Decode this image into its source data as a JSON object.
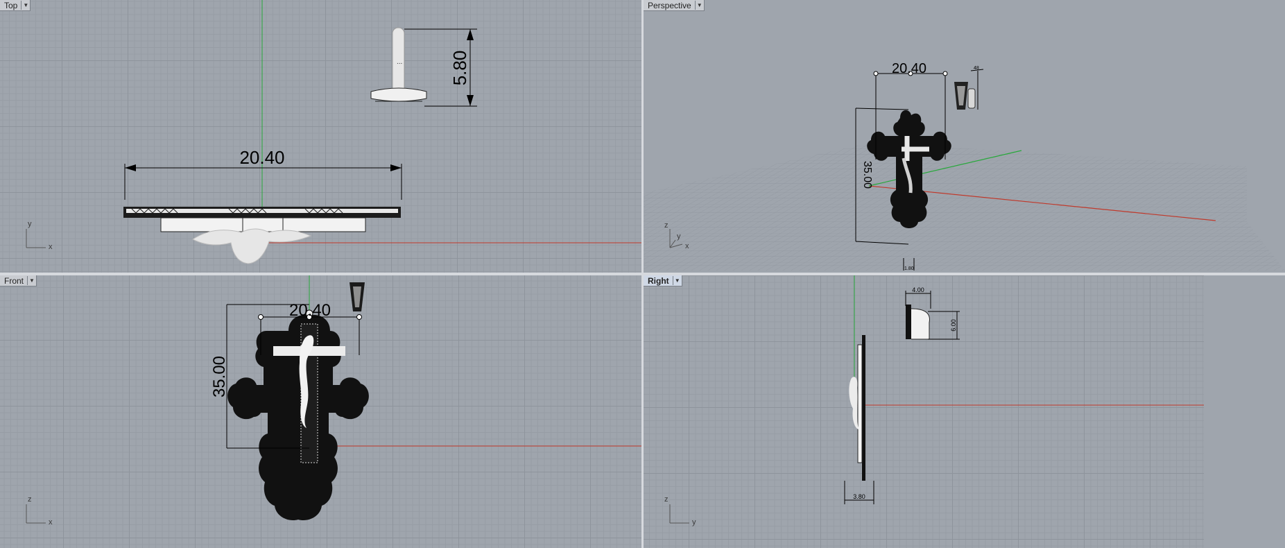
{
  "viewports": {
    "top": {
      "label": "Top"
    },
    "perspective": {
      "label": "Perspective"
    },
    "front": {
      "label": "Front"
    },
    "right": {
      "label": "Right"
    }
  },
  "dimensions": {
    "top_width": "20.40",
    "top_depth": "5.80",
    "persp_width": "20.40",
    "persp_height": "35.00",
    "persp_small": "48",
    "persp_bottom": "1.80",
    "front_width": "20.40",
    "front_height": "35.00",
    "right_bail_width": "4.00",
    "right_bail_height": "6.00",
    "right_thickness": "3.80"
  },
  "axes": {
    "top": {
      "h": "x",
      "v": "y"
    },
    "persp": {
      "h": "x",
      "m": "y",
      "v": "z"
    },
    "front": {
      "h": "x",
      "v": "z"
    },
    "right": {
      "h": "y",
      "v": "z"
    }
  },
  "colors": {
    "x_axis": "#c0392b",
    "y_axis": "#27a83a",
    "grid_major": "#8e949c",
    "viewport_bg": "#9fa5ad",
    "active_tab": "#cfd8e6"
  },
  "icons": {
    "viewport_menu": "chevron-down-icon"
  }
}
